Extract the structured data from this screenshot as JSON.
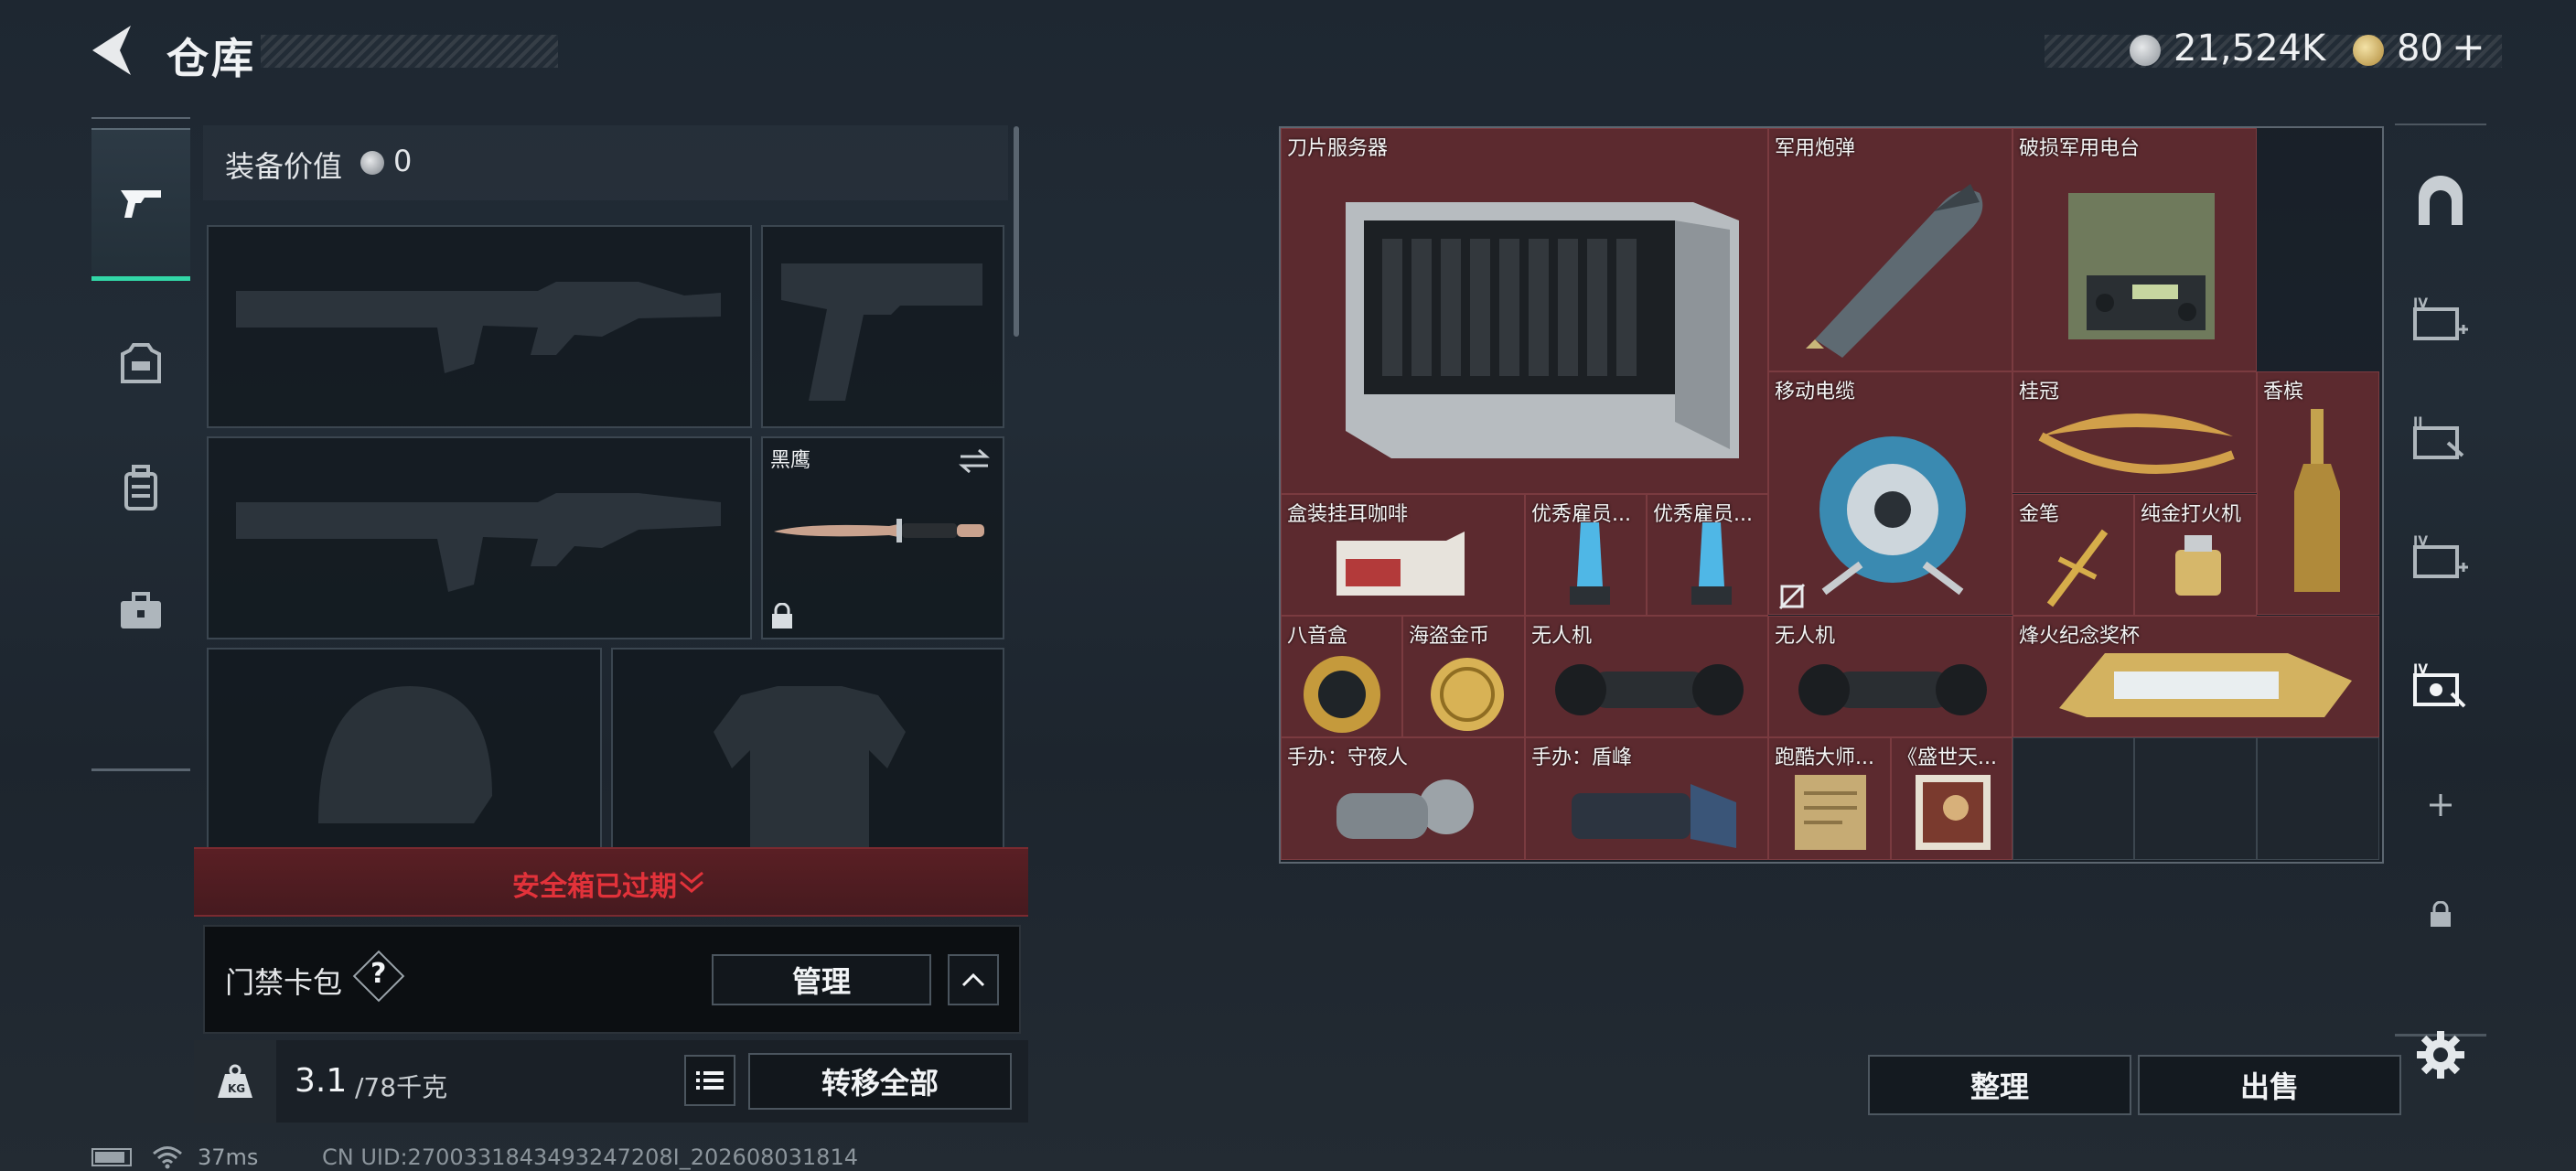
{
  "header": {
    "title": "仓库"
  },
  "currency": {
    "coins": "21,524K",
    "tokens": "80",
    "plus": "+"
  },
  "loadout": {
    "equip_value_label": "装备价值",
    "equip_value": "0",
    "melee_name": "黑鹰"
  },
  "safe_box": {
    "status": "安全箱已过期"
  },
  "card_pack": {
    "label": "门禁卡包",
    "help": "?",
    "manage": "管理"
  },
  "capacity": {
    "current": "3.1",
    "max": "/78千克",
    "transfer_all": "转移全部"
  },
  "inventory": {
    "items": [
      {
        "id": "blade-server",
        "label": "刀片服务器"
      },
      {
        "id": "military-shell",
        "label": "军用炮弹"
      },
      {
        "id": "radio",
        "label": "破损军用电台"
      },
      {
        "id": "cable-reel",
        "label": "移动电缆"
      },
      {
        "id": "laurel",
        "label": "桂冠"
      },
      {
        "id": "champagne",
        "label": "香槟"
      },
      {
        "id": "coffee",
        "label": "盒装挂耳咖啡"
      },
      {
        "id": "trophy1",
        "label": "优秀雇员..."
      },
      {
        "id": "trophy2",
        "label": "优秀雇员..."
      },
      {
        "id": "gold-pen",
        "label": "金笔"
      },
      {
        "id": "lighter",
        "label": "纯金打火机"
      },
      {
        "id": "music-box",
        "label": "八音盒"
      },
      {
        "id": "pirate-coin",
        "label": "海盗金币"
      },
      {
        "id": "drone1",
        "label": "无人机"
      },
      {
        "id": "drone2",
        "label": "无人机"
      },
      {
        "id": "cup",
        "label": "烽火纪念奖杯"
      },
      {
        "id": "figure1",
        "label": "手办：守夜人"
      },
      {
        "id": "figure2",
        "label": "手办：盾峰"
      },
      {
        "id": "parkour",
        "label": "跑酷大师..."
      },
      {
        "id": "painting",
        "label": "《盛世天..."
      }
    ]
  },
  "actions": {
    "organize": "整理",
    "sell": "出售"
  },
  "status": {
    "ping": "37ms",
    "uid": "CN UID:2700331843493247208I_202608031814"
  },
  "colors": {
    "item_bg": "#5c2a2f",
    "safe_red": "#e2323a",
    "active_tab": "#32d7a7"
  }
}
